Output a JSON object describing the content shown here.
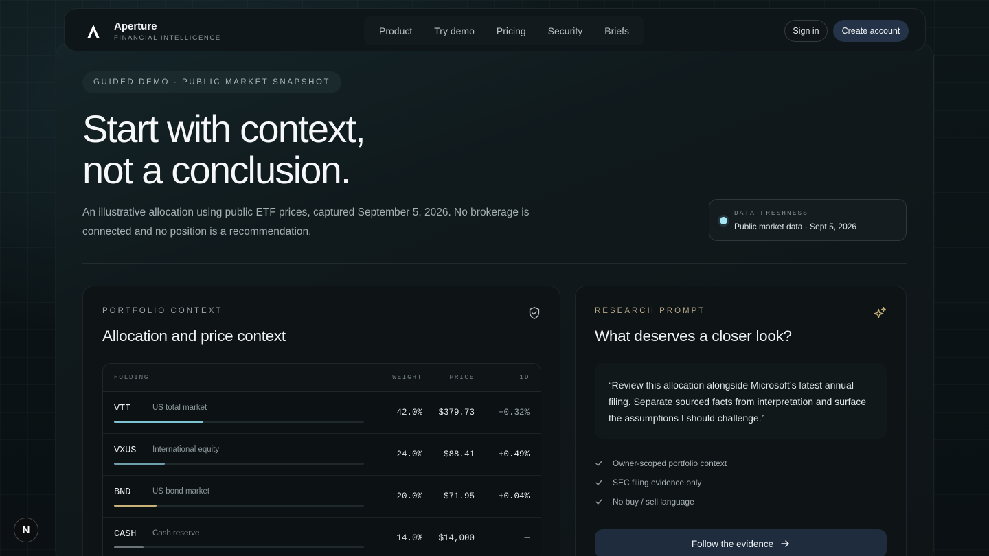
{
  "brand": {
    "title": "Aperture",
    "subtitle": "FINANCIAL INTELLIGENCE",
    "logo_icon": "aperture-a-logo"
  },
  "nav": {
    "links": [
      "Product",
      "Try demo",
      "Pricing",
      "Security",
      "Briefs"
    ],
    "sign_in": "Sign in",
    "create_account": "Create account"
  },
  "hero": {
    "eyebrow": "GUIDED DEMO · PUBLIC MARKET SNAPSHOT",
    "title_line1": "Start with context,",
    "title_line2": "not a conclusion.",
    "lede": "An illustrative allocation using public ETF prices, captured September 5, 2026. No brokerage is connected and no position is a recommendation."
  },
  "freshness": {
    "label": "DATA FRESHNESS",
    "value": "Public market data · Sept 5, 2026",
    "dot_color": "#a7e6f5"
  },
  "portfolio": {
    "eyebrow": "PORTFOLIO CONTEXT",
    "title": "Allocation and price context",
    "icon": "shield-check-icon",
    "columns": {
      "holding": "HOLDING",
      "weight": "WEIGHT",
      "price": "PRICE",
      "change": "1D"
    },
    "rows": [
      {
        "ticker": "VTI",
        "desc": "US total market",
        "weight": "42.0%",
        "price": "$379.73",
        "change": "−0.32%",
        "allocation": 0.42,
        "bar_color": "#7ec3d4",
        "trend": "neg"
      },
      {
        "ticker": "VXUS",
        "desc": "International equity",
        "weight": "24.0%",
        "price": "$88.41",
        "change": "+0.49%",
        "allocation": 0.24,
        "bar_color": "#6e9fab",
        "trend": "pos"
      },
      {
        "ticker": "BND",
        "desc": "US bond market",
        "weight": "20.0%",
        "price": "$71.95",
        "change": "+0.04%",
        "allocation": 0.2,
        "bar_color": "#c9b27a",
        "trend": "pos"
      },
      {
        "ticker": "CASH",
        "desc": "Cash reserve",
        "weight": "14.0%",
        "price": "$14,000",
        "change": "—",
        "allocation": 0.14,
        "bar_color": "#6b7476",
        "trend": "flat"
      }
    ]
  },
  "research": {
    "eyebrow": "RESEARCH PROMPT",
    "title": "What deserves a closer look?",
    "icon": "sparkle-icon",
    "quote": "“Review this allocation alongside Microsoft’s latest annual filing. Separate sourced facts from interpretation and surface the assumptions I should challenge.”",
    "checks": [
      "Owner-scoped portfolio context",
      "SEC filing evidence only",
      "No buy / sell language"
    ],
    "cta": "Follow the evidence"
  },
  "badge": "N"
}
